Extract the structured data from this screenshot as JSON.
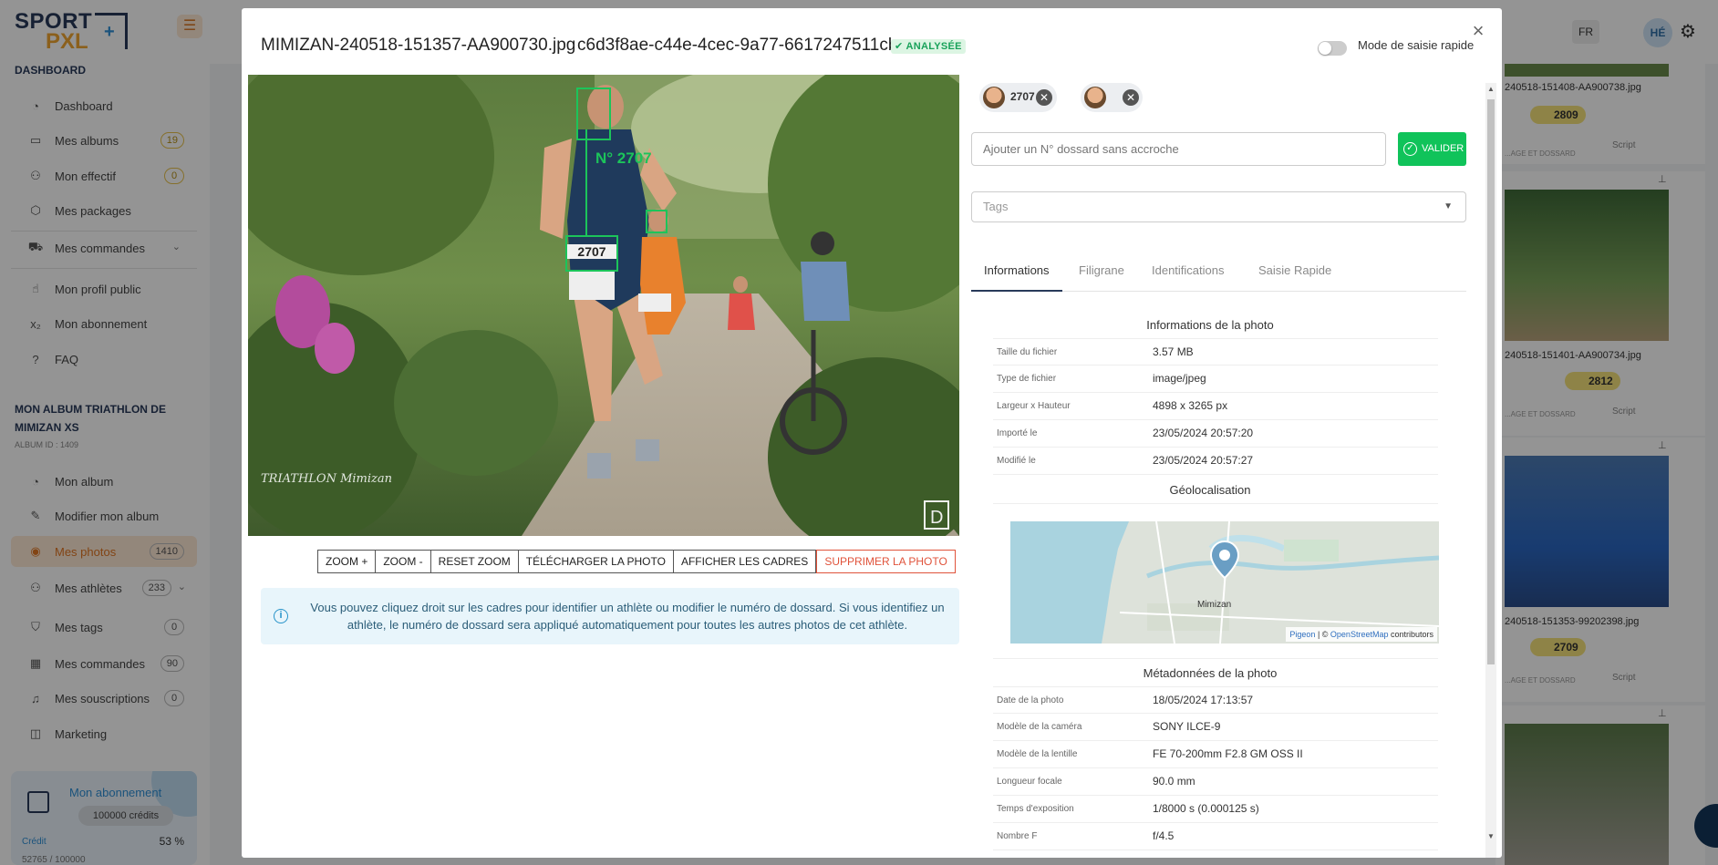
{
  "sidebar": {
    "logo_top": "SPORT",
    "logo_bottom": "PXL",
    "logo_plus": "+",
    "section_dashboard": "DASHBOARD",
    "dashboard_items": [
      {
        "label": "Dashboard",
        "icon": "dashboard-icon"
      },
      {
        "label": "Mes albums",
        "badge": "19",
        "icon": "albums-icon"
      },
      {
        "label": "Mon effectif",
        "badge": "0",
        "icon": "team-icon"
      },
      {
        "label": "Mes packages",
        "icon": "package-icon"
      },
      {
        "label": "Mes commandes",
        "icon": "cart-icon"
      },
      {
        "label": "Mon profil public",
        "icon": "profile-icon"
      },
      {
        "label": "Mon abonnement",
        "icon": "subscription-icon"
      },
      {
        "label": "FAQ",
        "icon": "help-icon"
      }
    ],
    "album_title_line1": "MON ALBUM TRIATHLON DE",
    "album_title_line2": "MIMIZAN XS",
    "album_id": "ALBUM ID : 1409",
    "album_items": [
      {
        "label": "Mon album",
        "icon": "album-icon"
      },
      {
        "label": "Modifier mon album",
        "icon": "edit-icon"
      },
      {
        "label": "Mes photos",
        "badge": "1410",
        "icon": "photos-icon"
      },
      {
        "label": "Mes athlètes",
        "badge": "233",
        "icon": "athletes-icon"
      },
      {
        "label": "Mes tags",
        "badge": "0",
        "icon": "tags-icon"
      },
      {
        "label": "Mes commandes",
        "badge": "90",
        "icon": "orders-icon"
      },
      {
        "label": "Mes souscriptions",
        "badge": "0",
        "icon": "bell-icon"
      },
      {
        "label": "Marketing",
        "icon": "marketing-icon"
      }
    ],
    "subscription": {
      "title": "Mon abonnement",
      "credits": "100000 crédits",
      "credit_label": "Crédit",
      "percent": "53 %",
      "value": "52765 / 100000"
    }
  },
  "topbar": {
    "lang": "FR",
    "avatar": "HÉ"
  },
  "gallery": [
    {
      "name": "240518-151408-AA900738.jpg",
      "tag": "2809",
      "small": "...AGE ET DOSSARD",
      "script": "Script"
    },
    {
      "name": "240518-151401-AA900734.jpg",
      "tag": "2812",
      "small": "...AGE ET DOSSARD",
      "script": "Script"
    },
    {
      "name": "240518-151353-99202398.jpg",
      "tag": "2709",
      "small": "...AGE ET DOSSARD",
      "script": "Script"
    }
  ],
  "modal": {
    "filename": "MIMIZAN-240518-151357-AA900730.jpg",
    "uuid": "c6d3f8ae-c44e-4cec-9a77-6617247511cb",
    "status_badge": "ANALYSÉE",
    "quick_mode_label": "Mode de saisie rapide",
    "quick_mode_on": false,
    "close": "×",
    "photo": {
      "face_label": "N° 2707",
      "bib_number": "2707",
      "watermark": "TRIATHLON Mimizan"
    },
    "tools": {
      "zoom_in": "ZOOM +",
      "zoom_out": "ZOOM -",
      "reset": "RESET ZOOM",
      "download": "TÉLÉCHARGER LA PHOTO",
      "frames": "AFFICHER LES CADRES",
      "delete": "SUPPRIMER LA PHOTO"
    },
    "info_text": "Vous pouvez cliquez droit sur les cadres pour identifier un athlète ou modifier le numéro de dossard. Si vous identifiez un athlète, le numéro de dossard sera appliqué automatiquement pour toutes les autres photos de cet athlète.",
    "chips": [
      {
        "number": "2707"
      },
      {
        "number": ""
      }
    ],
    "dossard_placeholder": "Ajouter un N° dossard sans accroche",
    "valider": "VALIDER",
    "tags_placeholder": "Tags",
    "tabs": [
      "Informations",
      "Filigrane",
      "Identifications",
      "Saisie Rapide"
    ],
    "photo_info_title": "Informations de la photo",
    "photo_info": [
      {
        "k": "Taille du fichier",
        "v": "3.57 MB"
      },
      {
        "k": "Type de fichier",
        "v": "image/jpeg"
      },
      {
        "k": "Largeur x Hauteur",
        "v": "4898 x 3265 px"
      },
      {
        "k": "Importé le",
        "v": "23/05/2024 20:57:20"
      },
      {
        "k": "Modifié le",
        "v": "23/05/2024 20:57:27"
      }
    ],
    "geo_title": "Géolocalisation",
    "map": {
      "place": "Mimizan",
      "attr_pigeon": "Pigeon",
      "attr_mid": " | © ",
      "attr_osm": "OpenStreetMap",
      "attr_end": " contributors"
    },
    "meta_title": "Métadonnées de la photo",
    "meta": [
      {
        "k": "Date de la photo",
        "v": "18/05/2024 17:13:57"
      },
      {
        "k": "Modèle de la caméra",
        "v": "SONY ILCE-9"
      },
      {
        "k": "Modèle de la lentille",
        "v": "FE 70-200mm F2.8 GM OSS II"
      },
      {
        "k": "Longueur focale",
        "v": "90.0 mm"
      },
      {
        "k": "Temps d'exposition",
        "v": "1/8000 s (0.000125 s)"
      },
      {
        "k": "Nombre F",
        "v": "f/4.5"
      }
    ]
  },
  "colors": {
    "accent": "#e07623",
    "brand_navy": "#283a5a",
    "success": "#10c35a",
    "danger": "#e0533b"
  }
}
